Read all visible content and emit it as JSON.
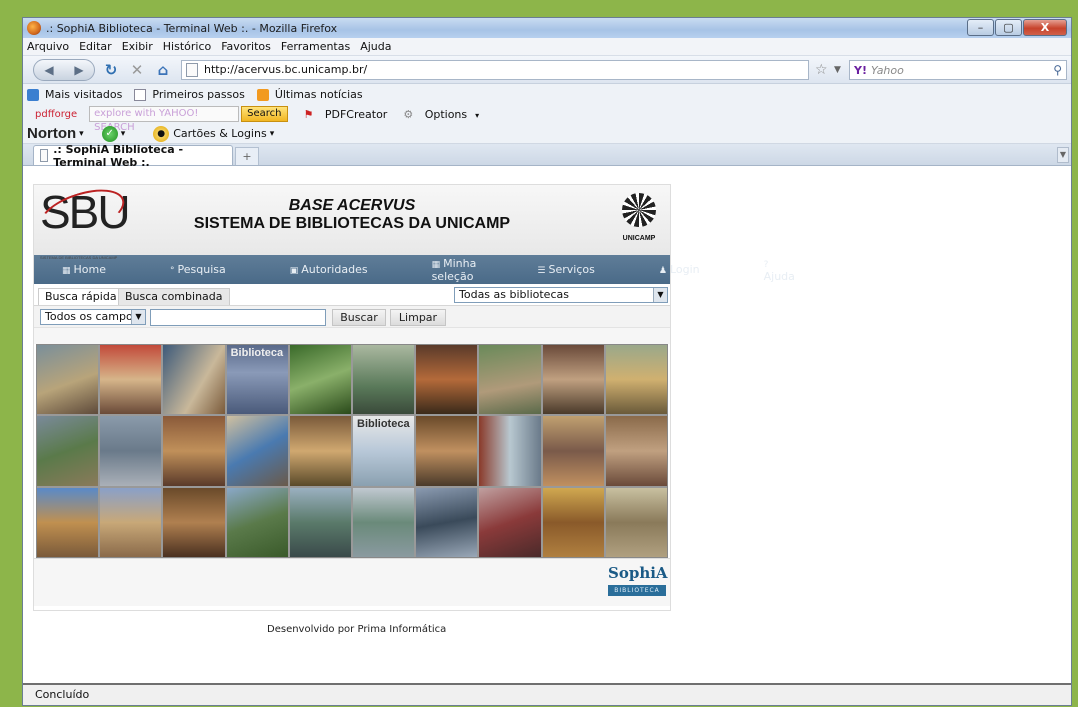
{
  "window": {
    "title": ".: SophiA Biblioteca - Terminal Web :. - Mozilla Firefox",
    "controls": [
      "–",
      "▢",
      "X"
    ]
  },
  "menu": [
    "Arquivo",
    "Editar",
    "Exibir",
    "Histórico",
    "Favoritos",
    "Ferramentas",
    "Ajuda"
  ],
  "navigation": {
    "url": "http://acervus.bc.unicamp.br/",
    "search_engine_placeholder": "Yahoo"
  },
  "bookmarks": [
    "Mais visitados",
    "Primeiros passos",
    "Últimas notícias"
  ],
  "toolbar_pdf": {
    "brand": "pdfforge",
    "yahoo_search_placeholder": "explore with YAHOO! SEARCH",
    "search_button": "Search",
    "pdfcreator": "PDFCreator",
    "options": "Options"
  },
  "toolbar_norton": {
    "brand": "Norton",
    "logins": "Cartões & Logins"
  },
  "tab": {
    "title": ".: SophiA Biblioteca - Terminal Web :.",
    "new_tab": "+"
  },
  "site": {
    "logo": "SBU",
    "logo_sub": "SISTEMA DE BIBLIOTECAS DA UNICAMP",
    "header_line1": "BASE ACERVUS",
    "header_line2": "SISTEMA DE BIBLIOTECAS DA UNICAMP",
    "unicamp": "UNICAMP",
    "nav": [
      {
        "icon": "▦",
        "label": "Home"
      },
      {
        "icon": "°",
        "label": "Pesquisa"
      },
      {
        "icon": "▣",
        "label": "Autoridades"
      },
      {
        "icon": "▦",
        "label": "Minha seleção"
      },
      {
        "icon": "☰",
        "label": "Serviços"
      },
      {
        "icon": "♟",
        "label": "Login"
      },
      {
        "icon": "?",
        "label": "Ajuda"
      }
    ],
    "search_tabs": [
      "Busca rápida",
      "Busca combinada"
    ],
    "library_select": "Todas as bibliotecas",
    "field_select": "Todos os campos",
    "search_value": "",
    "buscar": "Buscar",
    "limpar": "Limpar",
    "sophia_logo": "SophiA",
    "sophia_sub": "BIBLIOTECA",
    "mosaic_label_1": "Biblioteca",
    "mosaic_label_2": "Biblioteca"
  },
  "developed_by": "Desenvolvido por Prima Informática",
  "status": "Concluído",
  "colors": {
    "page_bg": "#8db54a",
    "nav_bar": "#4f6f8d",
    "nav_active": "#aee0ff"
  }
}
